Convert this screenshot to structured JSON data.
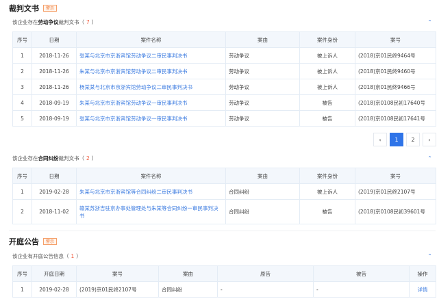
{
  "judgments": {
    "title": "裁判文书",
    "badge": "警示",
    "labor": {
      "prefix": "该企业存在",
      "keyword": "劳动争议",
      "suffix": "裁判文书（",
      "count": "7",
      "close": "）",
      "headers": [
        "序号",
        "日期",
        "案件名称",
        "案由",
        "案件身份",
        "案号"
      ],
      "rows": [
        [
          "1",
          "2018-11-26",
          "张某与北京市京浙宾馆劳动争议二审民事判决书",
          "劳动争议",
          "被上诉人",
          "(2018)京01民终9464号"
        ],
        [
          "2",
          "2018-11-26",
          "朱某与北京市京浙宾馆劳动争议二审民事判决书",
          "劳动争议",
          "被上诉人",
          "(2018)京01民终9460号"
        ],
        [
          "3",
          "2018-11-26",
          "杨某某与北京市京浙宾馆劳动争议二审民事判决书",
          "劳动争议",
          "被上诉人",
          "(2018)京01民终9466号"
        ],
        [
          "4",
          "2018-09-19",
          "朱某与北京市京浙宾馆劳动争议一审民事判决书",
          "劳动争议",
          "被告",
          "(2018)京0108民初17640号"
        ],
        [
          "5",
          "2018-09-19",
          "张某与北京市京浙宾馆劳动争议一审民事判决书",
          "劳动争议",
          "被告",
          "(2018)京0108民初17641号"
        ]
      ],
      "pagination": {
        "prev": "‹",
        "pages": [
          "1",
          "2"
        ],
        "current": "1",
        "next": "›"
      }
    },
    "contract": {
      "prefix": "该企业存在",
      "keyword": "合同纠纷",
      "suffix": "裁判文书（",
      "count": "2",
      "close": "）",
      "headers": [
        "序号",
        "日期",
        "案件名称",
        "案由",
        "案件身份",
        "案号"
      ],
      "rows": [
        [
          "1",
          "2019-02-28",
          "朱某与北京市京浙宾馆等合同纠纷二审民事判决书",
          "合同纠纷",
          "被上诉人",
          "(2019)京01民终2107号"
        ],
        [
          "2",
          "2018-11-02",
          "赣某苏浙吉驻京办事处管理处与朱某等合同纠纷一审民事判决书",
          "合同纠纷",
          "被告",
          "(2018)京0108民初39601号"
        ]
      ]
    }
  },
  "hearings": {
    "title": "开庭公告",
    "badge": "警示",
    "text": "该企业有开庭公告信息（",
    "count": "1",
    "close": "）",
    "headers": [
      "序号",
      "开庭日期",
      "案号",
      "案由",
      "原告",
      "被告",
      "操作"
    ],
    "rows": [
      [
        "1",
        "2019-02-28",
        "(2019)京01民终2107号",
        "合同纠纷",
        "-",
        "-",
        "详情"
      ]
    ]
  },
  "icons": {
    "collapse": "chevron-up-icon"
  }
}
